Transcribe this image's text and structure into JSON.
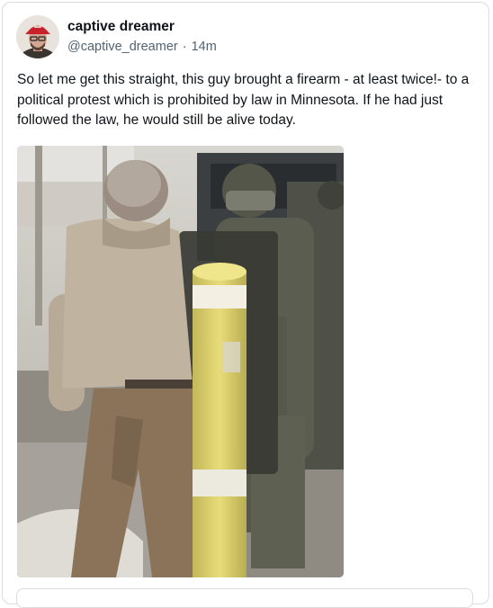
{
  "post": {
    "display_name": "captive dreamer",
    "handle": "@captive_dreamer",
    "separator": "·",
    "time_ago": "14m",
    "text": "So let me get this straight, this guy brought a firearm - at least twice!- to a political protest which is prohibited by law in Minnesota. If he had just followed the law, he would still be alive today."
  },
  "avatar": {
    "hat_color": "#c8232c"
  },
  "media": {
    "kind": "video-still",
    "pole_color": "#e6d770"
  }
}
